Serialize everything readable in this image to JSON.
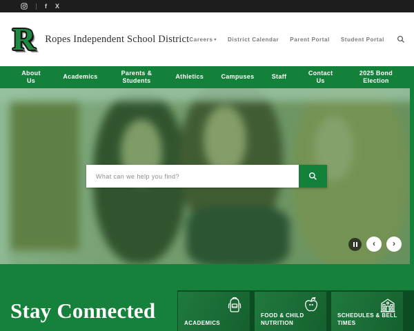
{
  "topbar": {
    "social": [
      {
        "name": "instagram-icon"
      },
      {
        "name": "facebook-icon",
        "glyph": "f"
      },
      {
        "name": "x-twitter-icon",
        "glyph": "X"
      }
    ]
  },
  "header": {
    "logo_letter": "R",
    "district_name": "Ropes Independent School District",
    "careers_caret": "▾",
    "links": [
      {
        "label": "Careers",
        "has_dropdown": true
      },
      {
        "label": "District Calendar"
      },
      {
        "label": "Parent Portal"
      },
      {
        "label": "Student Portal"
      }
    ],
    "search_icon": "magnifier"
  },
  "nav": {
    "items": [
      "About Us",
      "Academics",
      "Parents & Students",
      "Athletics",
      "Campuses",
      "Staff",
      "Contact Us",
      "2025 Bond Election"
    ]
  },
  "hero": {
    "search_placeholder": "What can we help you find?",
    "search_button_icon": "magnifier",
    "carousel": {
      "pause_icon": "pause",
      "prev_glyph": "‹",
      "next_glyph": "›"
    }
  },
  "bottom": {
    "heading": "Stay Connected",
    "tiles": [
      {
        "label": "ACADEMICS",
        "icon": "backpack-icon"
      },
      {
        "label": "FOOD & CHILD NUTRITION",
        "icon": "apple-icon"
      },
      {
        "label": "SCHEDULES & BELL TIMES",
        "icon": "school-building-icon"
      }
    ]
  },
  "colors": {
    "brand_green": "#14813a",
    "dark_green": "#0b4c23",
    "tile_green": "#1a6c36",
    "topbar_black": "#1d1d1d",
    "hero_overlay": "rgba(22,118,51,0.40)"
  }
}
